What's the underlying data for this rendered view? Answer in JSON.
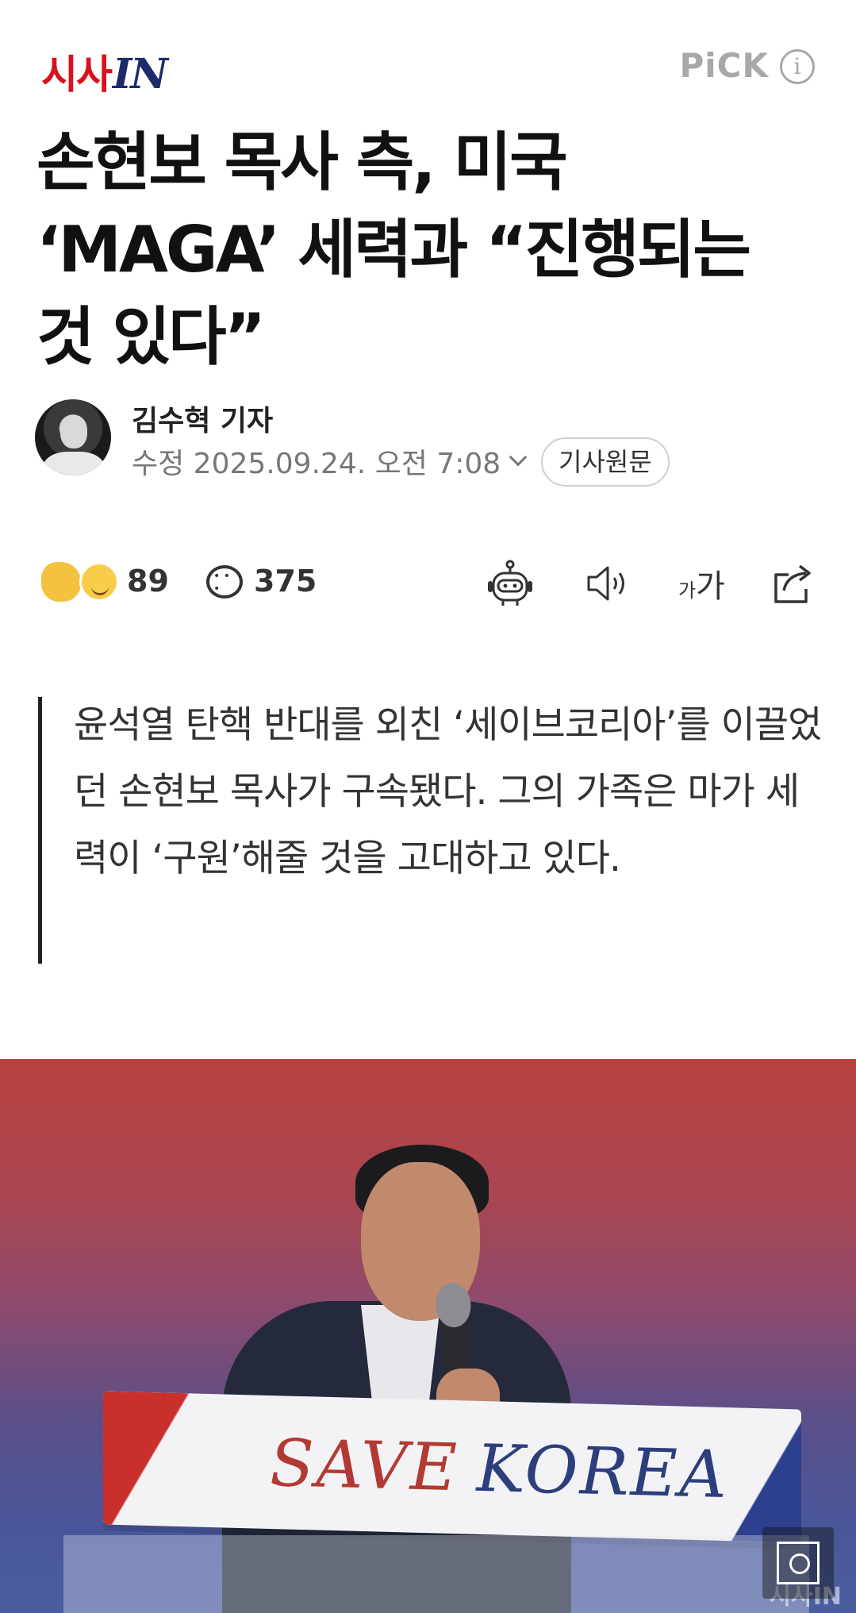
{
  "header": {
    "logo_korean": "시사",
    "logo_english": "IN",
    "pick_label": "PiCK",
    "info_icon": "info-icon"
  },
  "article": {
    "headline": "손현보 목사 측, 미국 ‘MAGA’ 세력과 “진행되는 것 있다”",
    "reporter": "김수혁 기자",
    "date_label": "수정 2025.09.24. 오전 7:08",
    "original_button": "기사원문",
    "summary": "윤석열 탄핵 반대를 외친 ‘세이브코리아’를 이끌었던 손현보 목사가 구속됐다. 그의 가족은 마가 세력이 ‘구원’해줄 것을 고대하고 있다."
  },
  "actions": {
    "reaction_count": "89",
    "comment_count": "375",
    "font_size_small": "가",
    "font_size_large": "가",
    "icons": [
      "reaction-emoji-icon",
      "comment-icon",
      "ai-summary-bot-icon",
      "speaker-icon",
      "font-size-icon",
      "share-icon"
    ]
  },
  "photo": {
    "podium_text_1": "SAVE",
    "podium_text_2": "KOREA",
    "watermark": "시사IN",
    "zoom_icon": "zoom-icon"
  },
  "colors": {
    "logo_red": "#d6121f",
    "logo_navy": "#1d2b6b",
    "pick_gray": "#a8a8a8",
    "text_dark": "#111111"
  }
}
